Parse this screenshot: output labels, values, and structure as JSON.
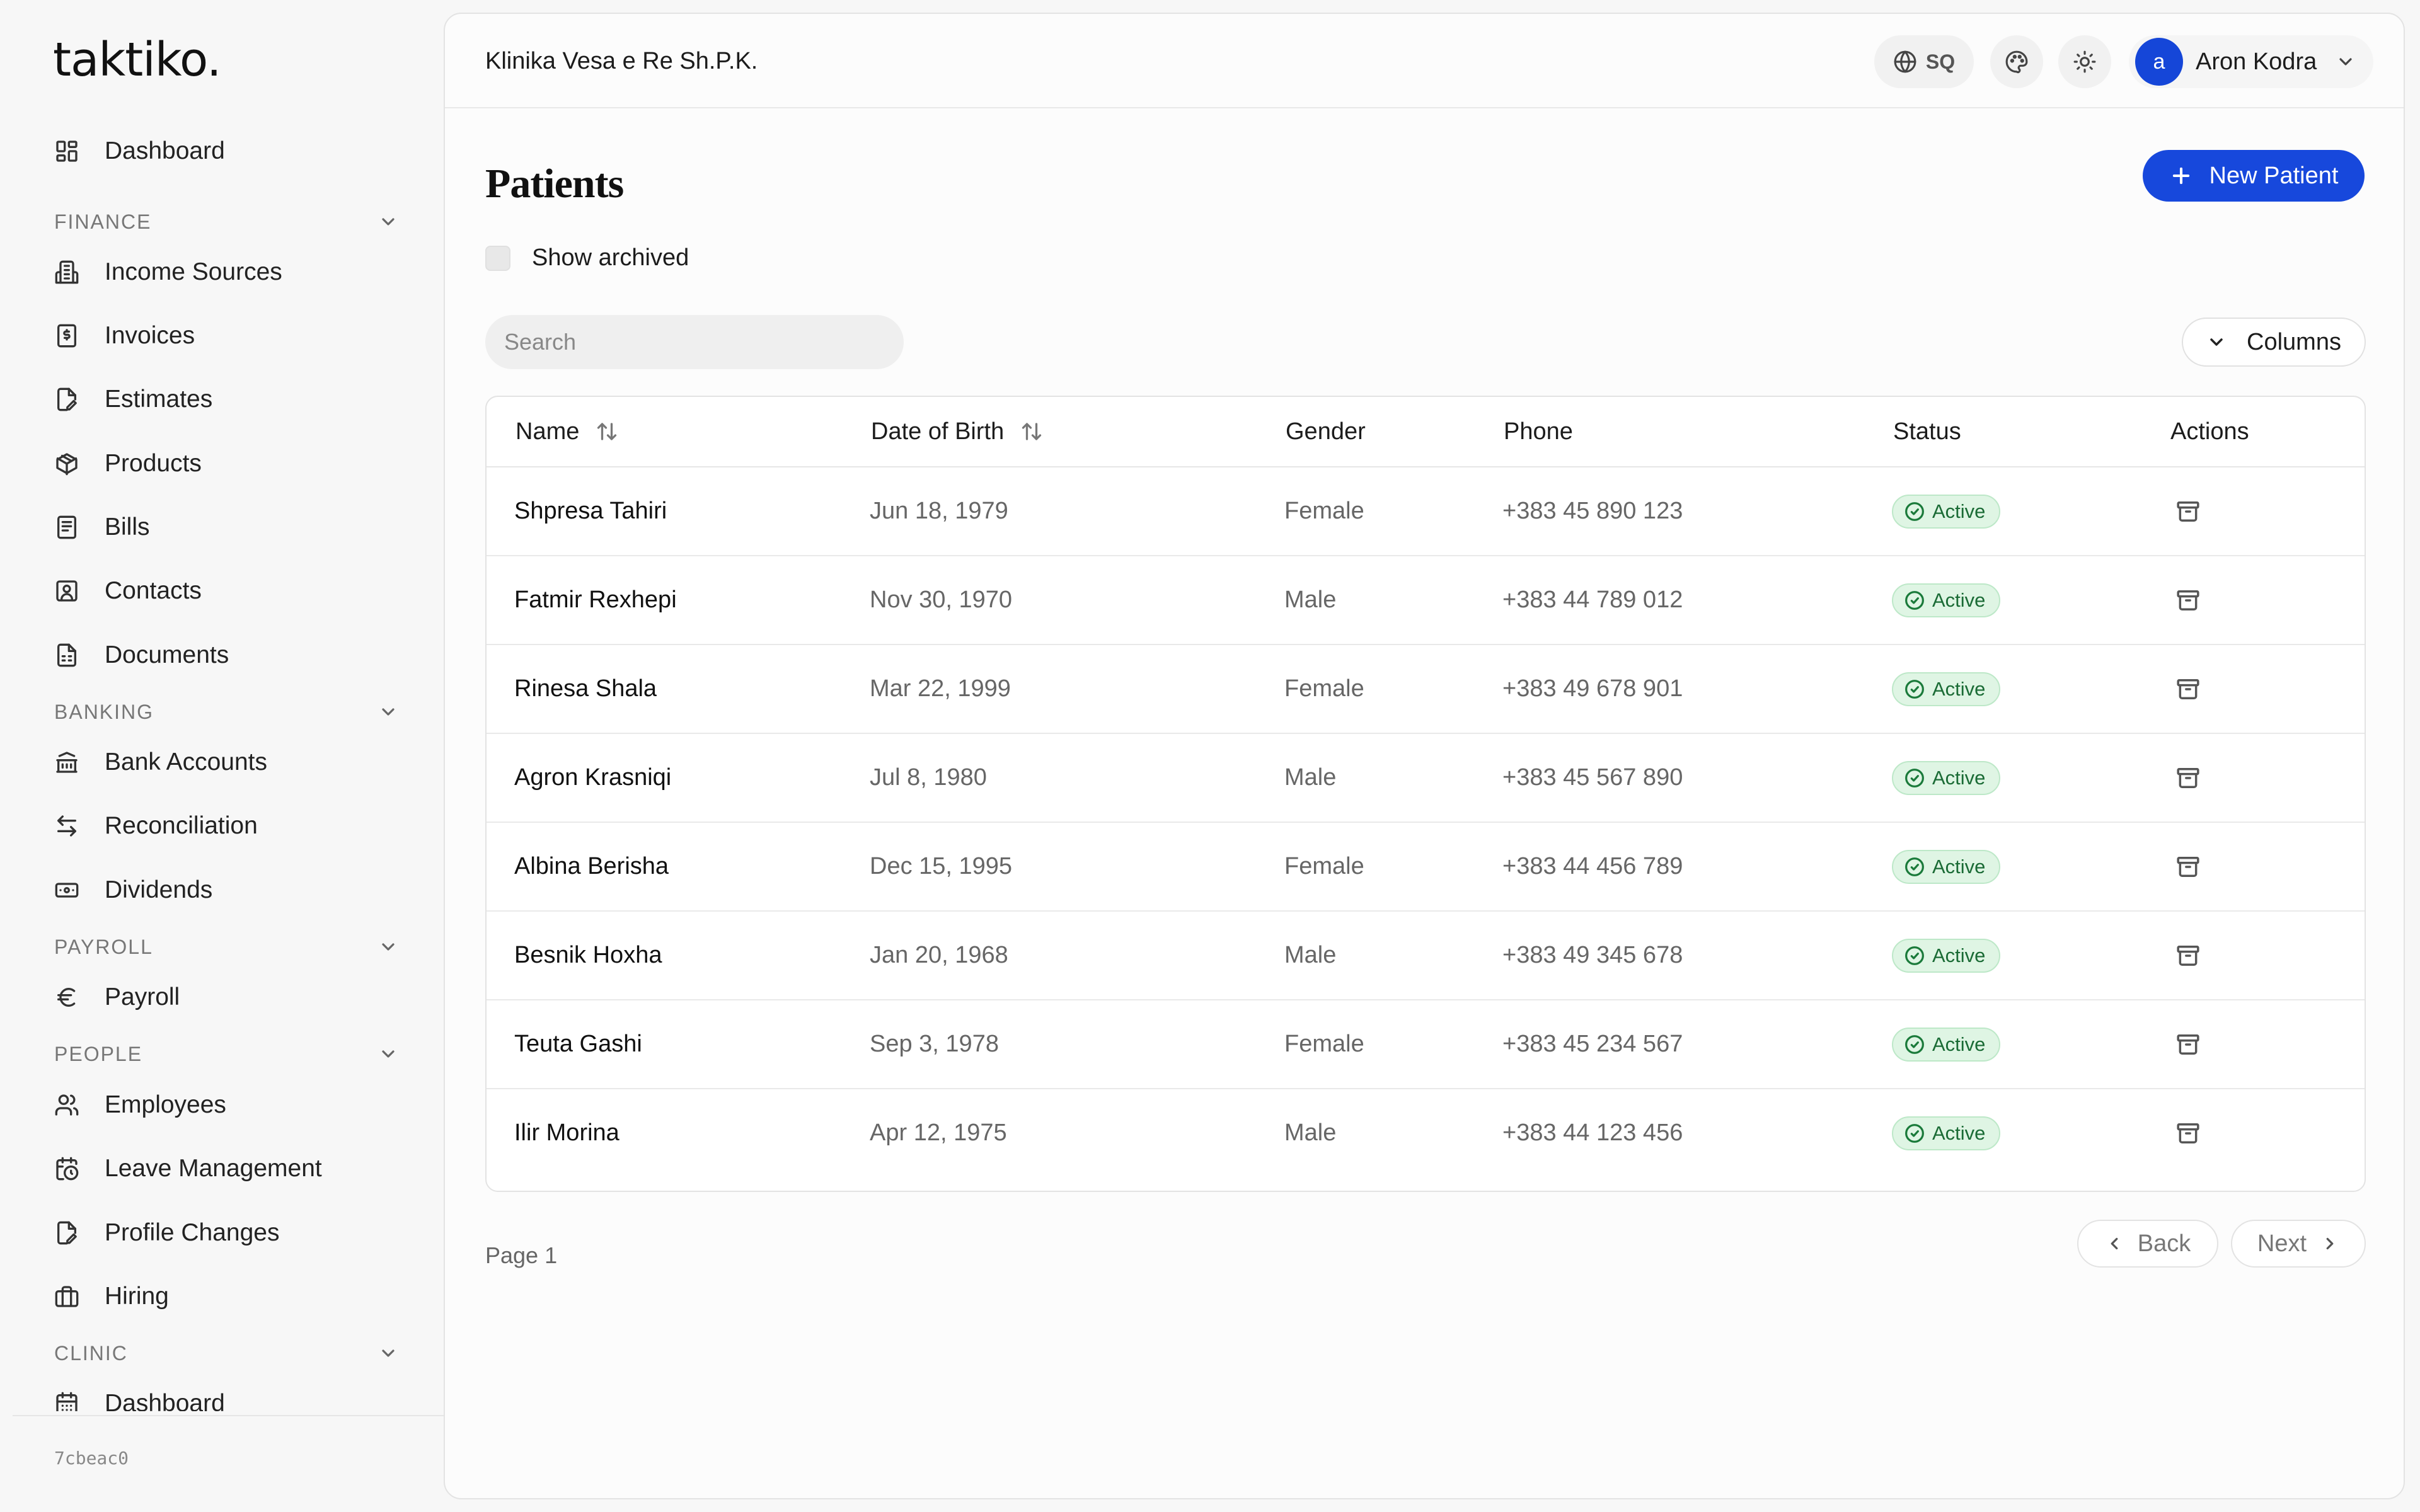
{
  "sidebar": {
    "logo": "taktiko.",
    "version": "7cbeac0",
    "items": {
      "dashboard": "Dashboard",
      "income_sources": "Income Sources",
      "invoices": "Invoices",
      "estimates": "Estimates",
      "products": "Products",
      "bills": "Bills",
      "contacts": "Contacts",
      "documents": "Documents",
      "bank_accounts": "Bank Accounts",
      "reconciliation": "Reconciliation",
      "dividends": "Dividends",
      "payroll": "Payroll",
      "employees": "Employees",
      "leave_management": "Leave Management",
      "profile_changes": "Profile Changes",
      "hiring": "Hiring",
      "clinic_dashboard": "Dashboard"
    },
    "sections": {
      "finance": "FINANCE",
      "banking": "BANKING",
      "payroll": "PAYROLL",
      "people": "PEOPLE",
      "clinic": "CLINIC"
    }
  },
  "header": {
    "org_name": "Klinika Vesa e Re Sh.P.K.",
    "language": "SQ",
    "user_initial": "a",
    "user_name": "Aron Kodra"
  },
  "main": {
    "title": "Patients",
    "new_button": "New Patient",
    "show_archived_label": "Show archived",
    "show_archived_checked": false,
    "search_placeholder": "Search",
    "search_value": "",
    "columns_button": "Columns"
  },
  "table": {
    "headers": {
      "name": "Name",
      "dob": "Date of Birth",
      "gender": "Gender",
      "phone": "Phone",
      "status": "Status",
      "actions": "Actions"
    },
    "rows": [
      {
        "name": "Shpresa Tahiri",
        "dob": "Jun 18, 1979",
        "gender": "Female",
        "phone": "+383 45 890 123",
        "status": "Active"
      },
      {
        "name": "Fatmir Rexhepi",
        "dob": "Nov 30, 1970",
        "gender": "Male",
        "phone": "+383 44 789 012",
        "status": "Active"
      },
      {
        "name": "Rinesa Shala",
        "dob": "Mar 22, 1999",
        "gender": "Female",
        "phone": "+383 49 678 901",
        "status": "Active"
      },
      {
        "name": "Agron Krasniqi",
        "dob": "Jul 8, 1980",
        "gender": "Male",
        "phone": "+383 45 567 890",
        "status": "Active"
      },
      {
        "name": "Albina Berisha",
        "dob": "Dec 15, 1995",
        "gender": "Female",
        "phone": "+383 44 456 789",
        "status": "Active"
      },
      {
        "name": "Besnik Hoxha",
        "dob": "Jan 20, 1968",
        "gender": "Male",
        "phone": "+383 49 345 678",
        "status": "Active"
      },
      {
        "name": "Teuta Gashi",
        "dob": "Sep 3, 1978",
        "gender": "Female",
        "phone": "+383 45 234 567",
        "status": "Active"
      },
      {
        "name": "Ilir Morina",
        "dob": "Apr 12, 1975",
        "gender": "Male",
        "phone": "+383 44 123 456",
        "status": "Active"
      }
    ]
  },
  "pagination": {
    "page_label": "Page 1",
    "back": "Back",
    "next": "Next"
  },
  "colors": {
    "accent": "#1748dc",
    "status_bg": "#dff5e4",
    "status_text": "#1a6b35"
  }
}
